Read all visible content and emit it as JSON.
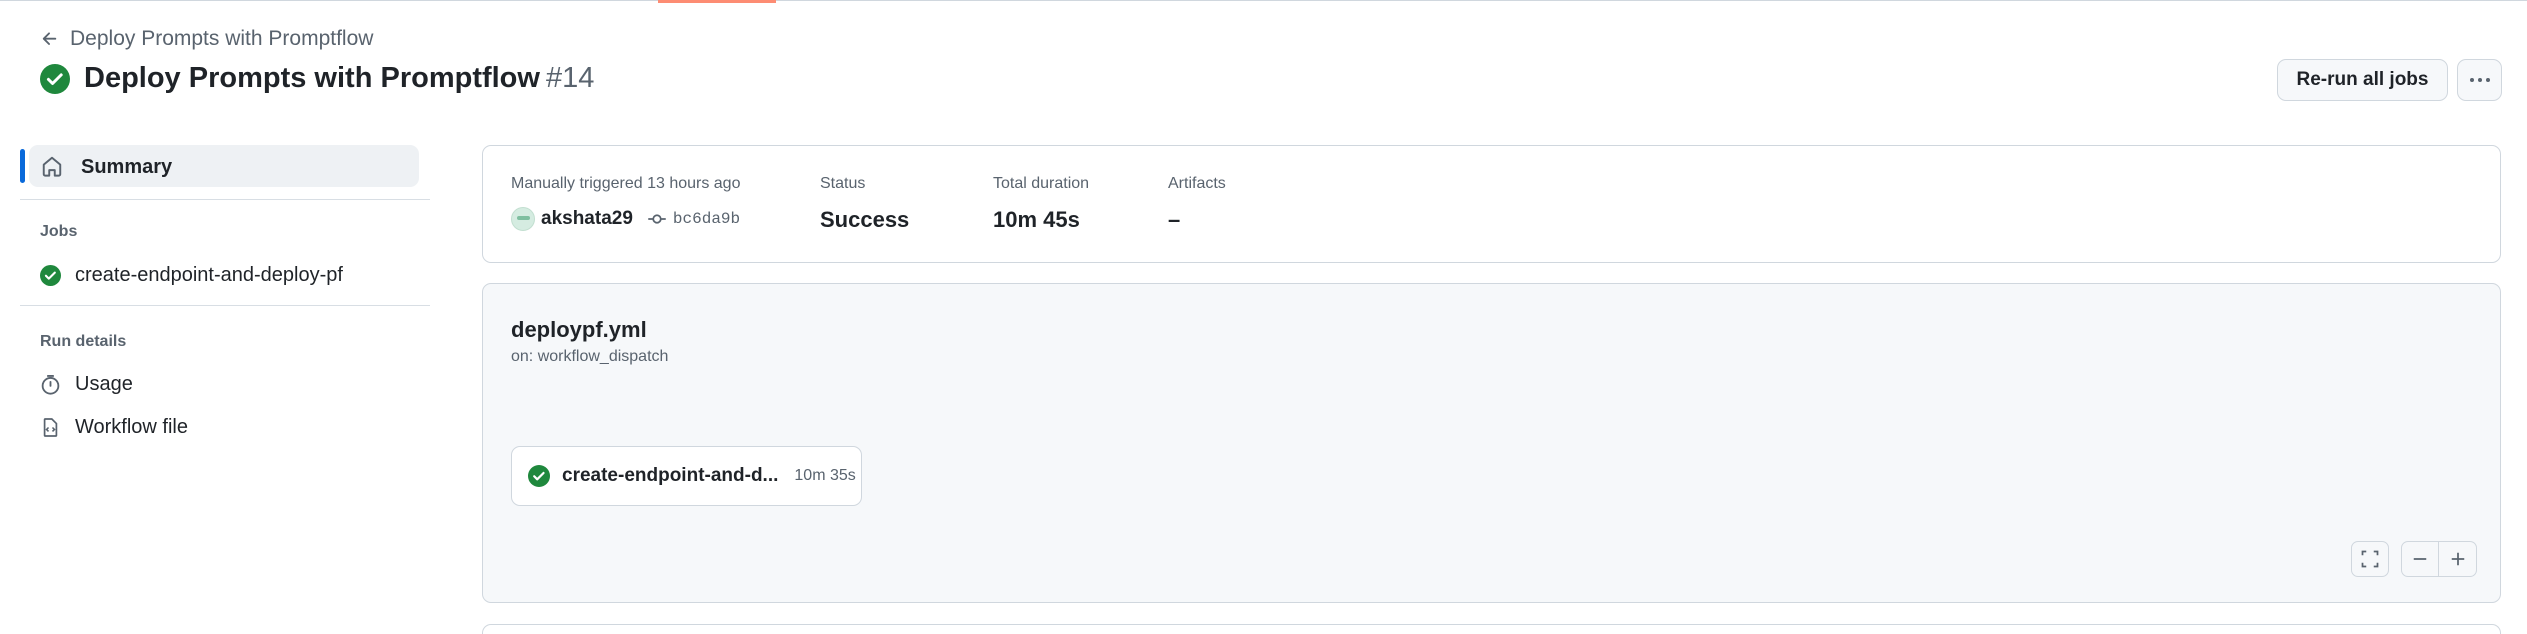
{
  "header": {
    "back_label": "Deploy Prompts with Promptflow",
    "title": "Deploy Prompts with Promptflow",
    "run_number": "#14",
    "rerun_label": "Re-run all jobs",
    "more_label": "···"
  },
  "sidebar": {
    "summary_label": "Summary",
    "jobs_heading": "Jobs",
    "jobs": [
      {
        "label": "create-endpoint-and-deploy-pf",
        "status": "success"
      }
    ],
    "run_details_heading": "Run details",
    "run_details": [
      {
        "label": "Usage",
        "icon": "stopwatch-icon"
      },
      {
        "label": "Workflow file",
        "icon": "file-code-icon"
      }
    ]
  },
  "summary": {
    "trigger_label": "Manually triggered 13 hours ago",
    "actor": "akshata29",
    "commit": "bc6da9b",
    "status_label": "Status",
    "status_value": "Success",
    "duration_label": "Total duration",
    "duration_value": "10m 45s",
    "artifacts_label": "Artifacts",
    "artifacts_value": "–"
  },
  "workflow": {
    "file": "deploypf.yml",
    "trigger": "on: workflow_dispatch",
    "job_name": "create-endpoint-and-d...",
    "job_time": "10m 35s"
  },
  "colors": {
    "success": "#1f883d",
    "accent": "#0969da",
    "top_indicator": "#fd8c73"
  }
}
